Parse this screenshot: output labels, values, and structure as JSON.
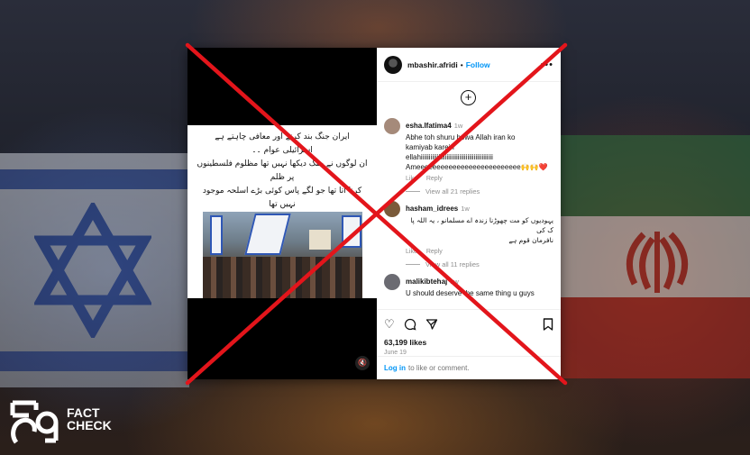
{
  "post": {
    "username": "mbashir.afridi",
    "follow_label": "Follow",
    "more_label": "•••",
    "add_label": "+",
    "media_text": [
      "ایران جنگ بند کرنے اور معافی چاہتے ہے",
      "اسرائیلی عوام ۔۔",
      "ان لوگوں نے جنگ دیکھا نہیں تھا مظلوم فلسطینوں پر ظلم",
      "کرنا آتا تھا جو لگے پاس کوئی بڑے اسلحہ موجود نہیں تھا"
    ],
    "comments": [
      {
        "user": "esha.lfatima4",
        "time": "1w",
        "lines": [
          "Abhe toh shuru howa Allah iran ko",
          "kamiyab karein",
          "ellahiiiiiiiiiiiiiiiiiiiiiiiiiiiiiiiiiiiiiiiiiiiii",
          "Ameeeeeeeeeeeeeeeeeeeeeeeeee🙌🙌❤️"
        ],
        "like_label": "Like",
        "reply_label": "Reply",
        "view_replies": "View all 21 replies",
        "avatar_color": "#a58a7a"
      },
      {
        "user": "hasham_idrees",
        "time": "1w",
        "lines": [
          "یہودیوں کو مت چھوڑنا زندہ اے مسلمانو ، یہ اللہ پاک کی",
          "نافرمان قوم ہے"
        ],
        "like_label": "Like",
        "reply_label": "Reply",
        "view_replies": "View all 11 replies",
        "avatar_color": "#7a5a3a"
      },
      {
        "user": "malikibtehaj",
        "time": "1w",
        "lines": [
          "U should deserve the same thing u guys"
        ],
        "avatar_color": "#6b6b72"
      }
    ],
    "likes": "63,199 likes",
    "date": "June 19",
    "login_link": "Log in",
    "login_suffix": "to like or comment."
  },
  "logo": {
    "line1": "FACT",
    "line2": "CHECK"
  },
  "colors": {
    "cross": "#e3151b",
    "link": "#0095f6"
  }
}
